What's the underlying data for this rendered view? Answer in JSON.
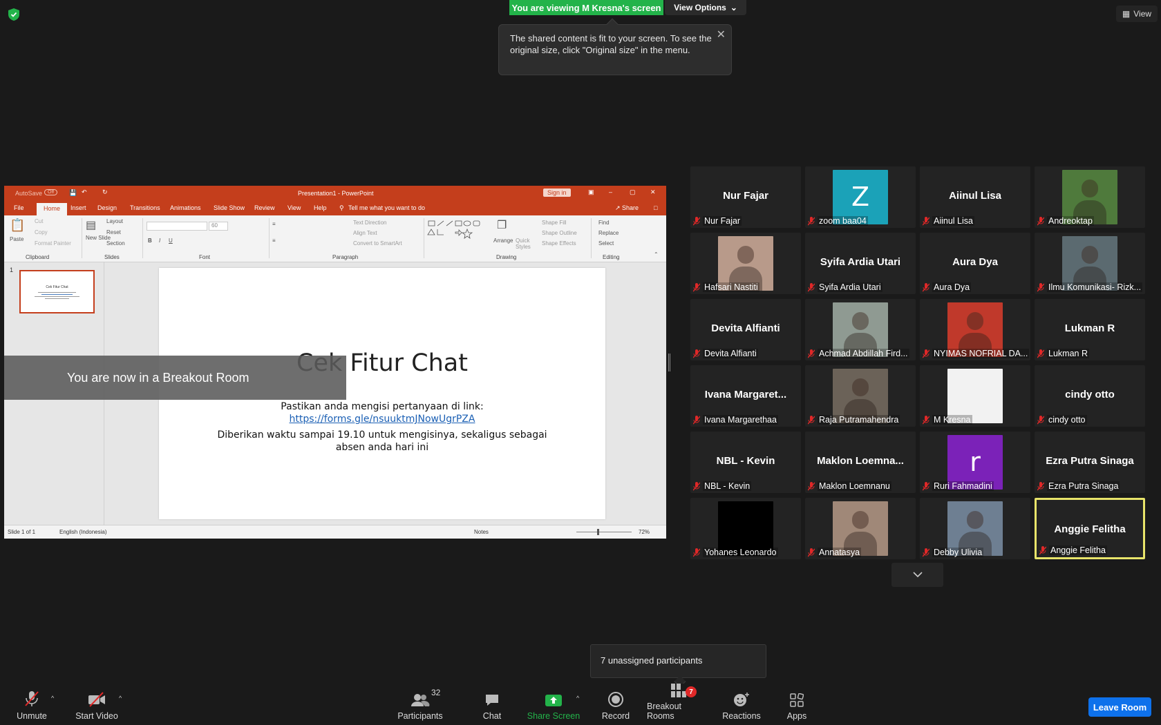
{
  "top": {
    "viewing_banner": "You are viewing M Kresna's screen",
    "view_options": "View Options",
    "view_button": "View"
  },
  "toast": {
    "message": "The shared content is fit to your screen. To see the original size, click \"Original size\" in the menu."
  },
  "ppt": {
    "autosave": "AutoSave",
    "autosave_state": "Off",
    "title": "Presentation1 - PowerPoint",
    "sign_in": "Sign in",
    "share": "Share",
    "tabs": [
      "File",
      "Home",
      "Insert",
      "Design",
      "Transitions",
      "Animations",
      "Slide Show",
      "Review",
      "View",
      "Help"
    ],
    "tell_me": "Tell me what you want to do",
    "groups": [
      "Clipboard",
      "Slides",
      "Font",
      "Paragraph",
      "Drawing",
      "Editing"
    ],
    "clipboard": {
      "paste": "Paste",
      "cut": "Cut",
      "copy": "Copy",
      "format_painter": "Format Painter"
    },
    "slides_grp": {
      "new_slide": "New Slide",
      "layout": "Layout",
      "reset": "Reset",
      "section": "Section"
    },
    "font_size": "60",
    "paragraph": {
      "text_direction": "Text Direction",
      "align_text": "Align Text",
      "convert": "Convert to SmartArt"
    },
    "drawing": {
      "arrange": "Arrange",
      "quick_styles": "Quick Styles",
      "shape_fill": "Shape Fill",
      "shape_outline": "Shape Outline",
      "shape_effects": "Shape Effects"
    },
    "editing": {
      "find": "Find",
      "replace": "Replace",
      "select": "Select"
    },
    "slide_number": "1",
    "slide": {
      "title": "Cek Fitur Chat",
      "line1": "Pastikan anda mengisi pertanyaan di link:",
      "link": "https://forms.gle/nsuuktmJNowUgrPZA",
      "line3": "Diberikan waktu sampai 19.10 untuk mengisinya, sekaligus sebagai",
      "line4": "absen anda hari ini"
    },
    "status": {
      "slide_of": "Slide 1 of 1",
      "language": "English (Indonesia)",
      "notes": "Notes",
      "zoom": "72%"
    }
  },
  "breakout_message": "You are now in a Breakout Room",
  "gallery": [
    {
      "display": "Nur Fajar",
      "name": "Nur Fajar",
      "kind": "text"
    },
    {
      "display": "Z",
      "name": "zoom baa04",
      "kind": "letter",
      "color": "#1ba2b8"
    },
    {
      "display": "Aiinul Lisa",
      "name": "Aiinul Lisa",
      "kind": "text"
    },
    {
      "display": "",
      "name": "Andreoktap",
      "kind": "photo",
      "color": "#4f7a3c"
    },
    {
      "display": "",
      "name": "Hafsari Nastiti",
      "kind": "photo",
      "color": "#b89a8a"
    },
    {
      "display": "Syifa Ardia Utari",
      "name": "Syifa Ardia Utari",
      "kind": "text"
    },
    {
      "display": "Aura Dya",
      "name": "Aura Dya",
      "kind": "text"
    },
    {
      "display": "",
      "name": "Ilmu Komunikasi- Rizk...",
      "kind": "photo",
      "color": "#5b6a70"
    },
    {
      "display": "Devita Alfianti",
      "name": "Devita Alfianti",
      "kind": "text"
    },
    {
      "display": "",
      "name": "Achmad Abdillah Fird...",
      "kind": "photo",
      "color": "#8f9a92"
    },
    {
      "display": "",
      "name": "NYIMAS NOFRIAL DA...",
      "kind": "photo",
      "color": "#c0392b"
    },
    {
      "display": "Lukman R",
      "name": "Lukman R",
      "kind": "text"
    },
    {
      "display": "Ivana  Margaret...",
      "name": "Ivana Margarethaa",
      "kind": "text"
    },
    {
      "display": "",
      "name": "Raja Putramahendra",
      "kind": "photo",
      "color": "#6b6258"
    },
    {
      "display": "",
      "name": "M Kresna",
      "kind": "photo",
      "color": "#f2f2f2"
    },
    {
      "display": "cindy otto",
      "name": "cindy otto",
      "kind": "text"
    },
    {
      "display": "NBL - Kevin",
      "name": "NBL - Kevin",
      "kind": "text"
    },
    {
      "display": "Maklon  Loemna...",
      "name": "Maklon Loemnanu",
      "kind": "text"
    },
    {
      "display": "r",
      "name": "Ruri Fahmadini",
      "kind": "letter",
      "color": "#7b22b8"
    },
    {
      "display": "Ezra Putra Sinaga",
      "name": "Ezra Putra Sinaga",
      "kind": "text"
    },
    {
      "display": "",
      "name": "Yohanes Leonardo",
      "kind": "photo",
      "color": "#000000"
    },
    {
      "display": "",
      "name": "Annatasya",
      "kind": "photo",
      "color": "#a08878"
    },
    {
      "display": "",
      "name": "Debby Ulivia",
      "kind": "photo",
      "color": "#6e7f92"
    },
    {
      "display": "Anggie Felitha",
      "name": "Anggie Felitha",
      "kind": "text",
      "active": true
    }
  ],
  "unassigned": "7 unassigned participants",
  "toolbar": {
    "unmute": "Unmute",
    "start_video": "Start Video",
    "participants": "Participants",
    "participants_count": "32",
    "chat": "Chat",
    "share_screen": "Share Screen",
    "record": "Record",
    "breakout_rooms": "Breakout Rooms",
    "breakout_badge": "7",
    "reactions": "Reactions",
    "apps": "Apps",
    "leave_room": "Leave Room"
  },
  "colors": {
    "accent_green": "#23b34a",
    "leave_blue": "#0e71eb",
    "ppt_orange": "#c43e1c",
    "active_speaker": "#e8e46a"
  }
}
